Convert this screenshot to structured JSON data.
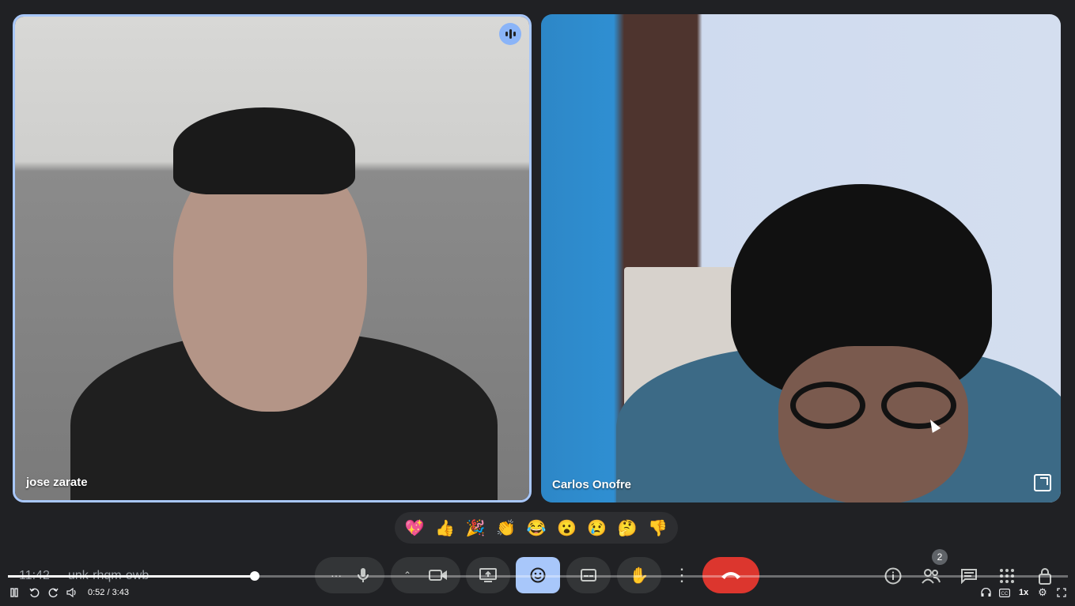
{
  "participants": [
    {
      "name": "jose zarate",
      "speaking": true
    },
    {
      "name": "Carlos Onofre",
      "speaking": false
    }
  ],
  "reactions": [
    {
      "icon": "sparkling-heart-icon",
      "glyph": "💖"
    },
    {
      "icon": "thumbs-up-icon",
      "glyph": "👍"
    },
    {
      "icon": "party-popper-icon",
      "glyph": "🎉"
    },
    {
      "icon": "clapping-hands-icon",
      "glyph": "👏"
    },
    {
      "icon": "tears-of-joy-icon",
      "glyph": "😂"
    },
    {
      "icon": "surprised-face-icon",
      "glyph": "😮"
    },
    {
      "icon": "sad-face-icon",
      "glyph": "😢"
    },
    {
      "icon": "thinking-face-icon",
      "glyph": "🤔"
    },
    {
      "icon": "thumbs-down-icon",
      "glyph": "👎"
    }
  ],
  "meeting": {
    "clock": "11:42",
    "code": "unk-rhqm-owb",
    "people_count": "2"
  },
  "player": {
    "time_display": "0:52 / 3:43",
    "progress": 0.233,
    "speed": "1x"
  },
  "colors": {
    "background": "#202124",
    "active_speaker_border": "#a8c7fa",
    "end_call": "#dc362e"
  }
}
